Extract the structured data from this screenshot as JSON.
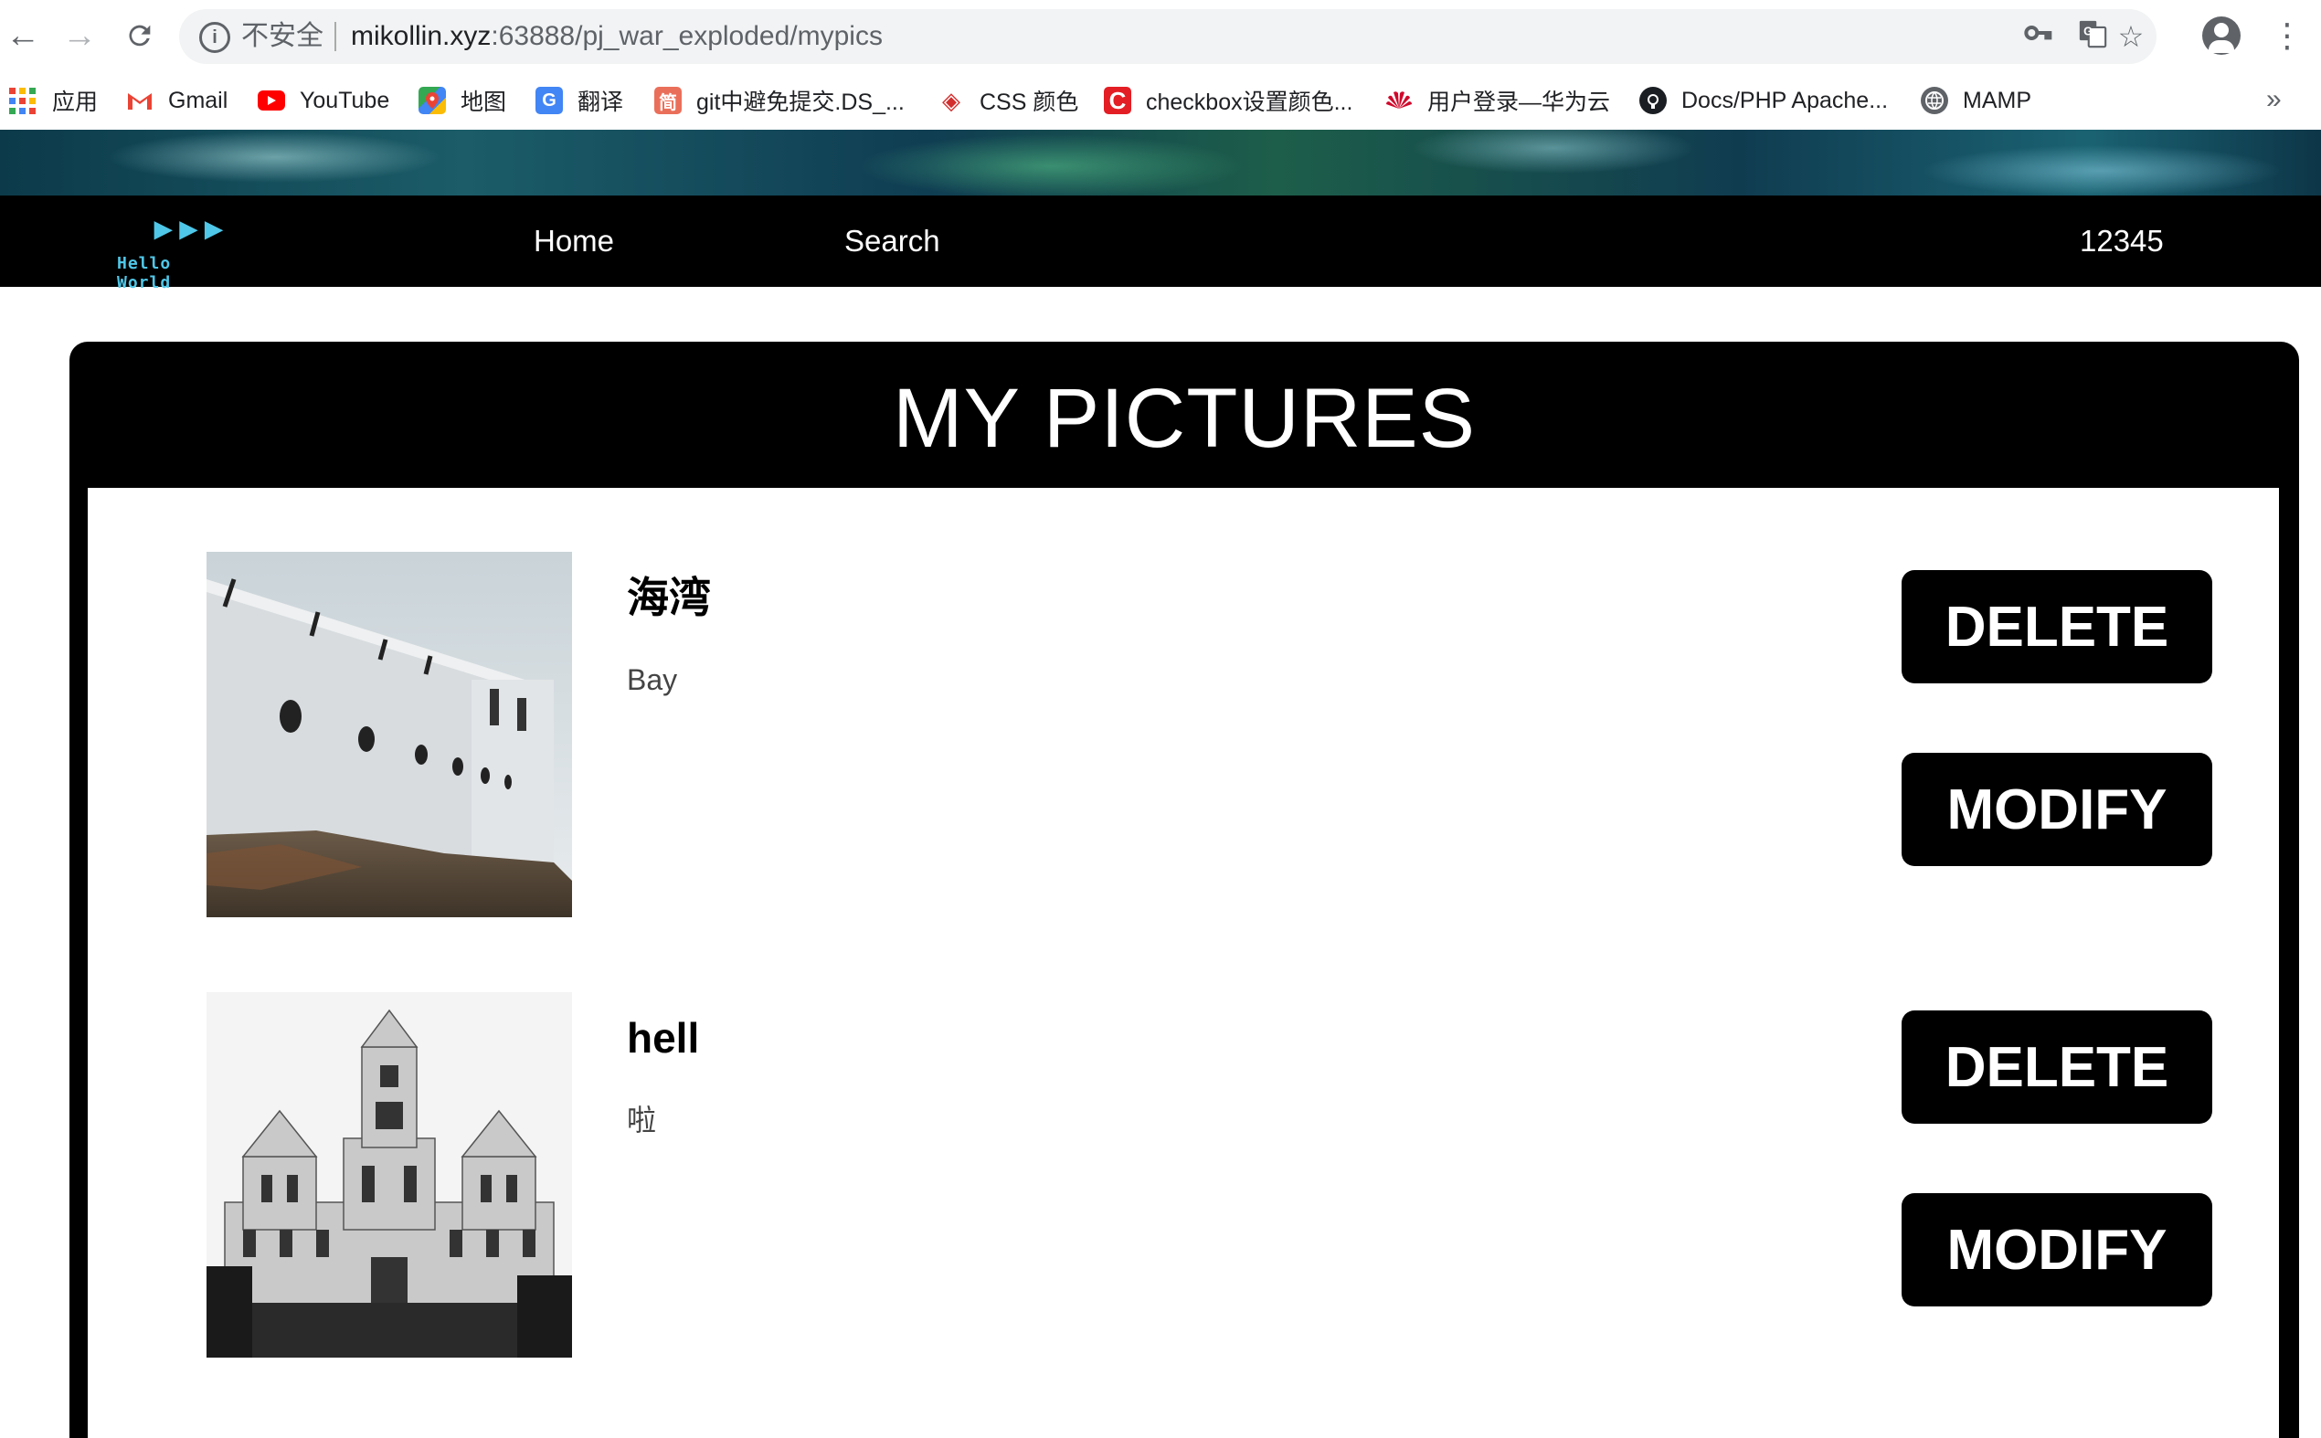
{
  "browser": {
    "insecure_label": "不安全",
    "url_host": "mikollin.xyz",
    "url_rest": ":63888/pj_war_exploded/mypics"
  },
  "bookmarks": [
    {
      "label": "应用",
      "icon": "apps-icon"
    },
    {
      "label": "Gmail",
      "icon": "gmail-icon"
    },
    {
      "label": "YouTube",
      "icon": "youtube-icon"
    },
    {
      "label": "地图",
      "icon": "maps-icon"
    },
    {
      "label": "翻译",
      "icon": "translate-icon"
    },
    {
      "label": "git中避免提交.DS_...",
      "icon": "jianshu-icon"
    },
    {
      "label": "CSS 颜色",
      "icon": "css-icon"
    },
    {
      "label": "checkbox设置颜色...",
      "icon": "csdn-icon"
    },
    {
      "label": "用户登录—华为云",
      "icon": "huawei-icon"
    },
    {
      "label": "Docs/PHP Apache...",
      "icon": "github-icon"
    },
    {
      "label": "MAMP",
      "icon": "globe-icon"
    }
  ],
  "site": {
    "logo_text": "Hello World",
    "nav": {
      "home": "Home",
      "search": "Search",
      "user": "12345"
    }
  },
  "page": {
    "title": "MY PICTURES",
    "items": [
      {
        "title": "海湾",
        "description": "Bay",
        "delete_label": "DELETE",
        "modify_label": "MODIFY"
      },
      {
        "title": "hell",
        "description": "啦",
        "delete_label": "DELETE",
        "modify_label": "MODIFY"
      }
    ]
  },
  "colors": {
    "nav_bg": "#000000",
    "logo": "#4fc7e8",
    "button_bg": "#000000"
  }
}
